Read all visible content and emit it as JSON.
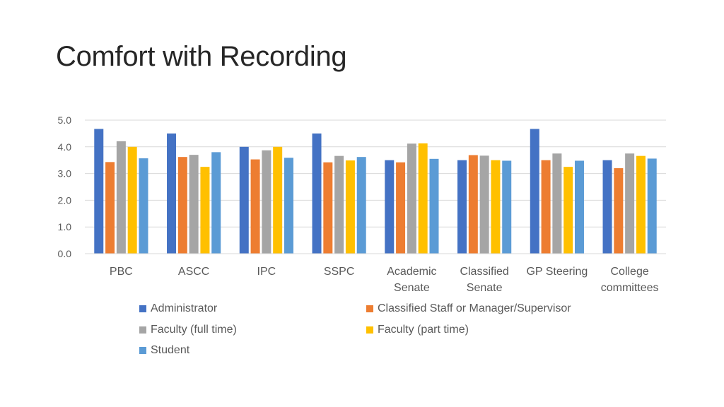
{
  "slide": {
    "title": "Comfort with Recording"
  },
  "chart_data": {
    "type": "bar",
    "title": "",
    "xlabel": "",
    "ylabel": "",
    "ylim": [
      0,
      5
    ],
    "yticks": [
      "0.0",
      "1.0",
      "2.0",
      "3.0",
      "4.0",
      "5.0"
    ],
    "grid": true,
    "legend_position": "bottom",
    "categories": [
      [
        "PBC"
      ],
      [
        "ASCC"
      ],
      [
        "IPC"
      ],
      [
        "SSPC"
      ],
      [
        "Academic",
        "Senate"
      ],
      [
        "Classified",
        "Senate"
      ],
      [
        "GP Steering"
      ],
      [
        "College",
        "committees"
      ]
    ],
    "series": [
      {
        "name": "Administrator",
        "color": "#4472C4",
        "values": [
          4.67,
          4.5,
          4.0,
          4.5,
          3.5,
          3.5,
          4.67,
          3.5
        ]
      },
      {
        "name": "Classified Staff or Manager/Supervisor",
        "color": "#ED7D31",
        "values": [
          3.43,
          3.62,
          3.53,
          3.42,
          3.42,
          3.69,
          3.5,
          3.2
        ]
      },
      {
        "name": "Faculty (full time)",
        "color": "#A5A5A5",
        "values": [
          4.21,
          3.7,
          3.87,
          3.66,
          4.12,
          3.67,
          3.75,
          3.75
        ]
      },
      {
        "name": "Faculty (part time)",
        "color": "#FFC000",
        "values": [
          4.0,
          3.25,
          4.0,
          3.49,
          4.13,
          3.5,
          3.25,
          3.66
        ]
      },
      {
        "name": "Student",
        "color": "#5B9BD5",
        "values": [
          3.57,
          3.8,
          3.59,
          3.62,
          3.55,
          3.48,
          3.48,
          3.56
        ]
      }
    ]
  }
}
